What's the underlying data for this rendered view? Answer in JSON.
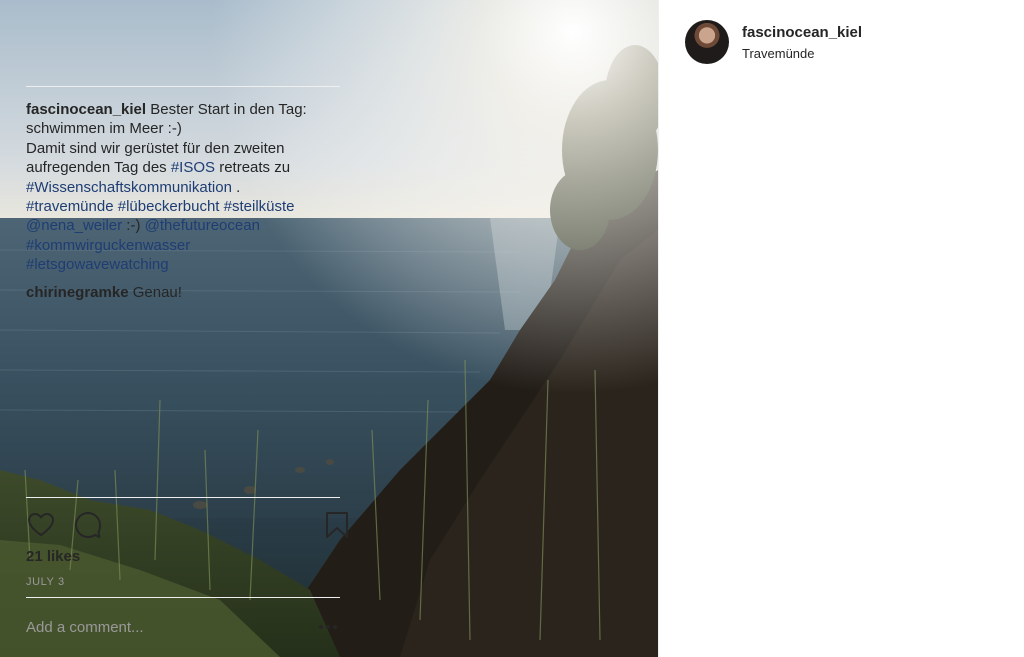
{
  "post": {
    "username": "fascinocean_kiel",
    "location": "Travemünde",
    "caption_lines": [
      [
        {
          "t": "fascinocean_kiel",
          "kind": "user"
        },
        {
          "t": " Bester Start in den Tag:",
          "kind": "text"
        }
      ],
      [
        {
          "t": "schwimmen im Meer :-)",
          "kind": "text"
        }
      ],
      [
        {
          "t": "Damit sind wir gerüstet für den zweiten",
          "kind": "text"
        }
      ],
      [
        {
          "t": "aufregenden Tag des ",
          "kind": "text"
        },
        {
          "t": "#ISOS",
          "kind": "tag"
        },
        {
          "t": " retreats zu",
          "kind": "text"
        }
      ],
      [
        {
          "t": "#Wissenschaftskommunikation",
          "kind": "tag"
        },
        {
          "t": " .",
          "kind": "text"
        }
      ],
      [
        {
          "t": "#travemünde",
          "kind": "tag"
        },
        {
          "t": " ",
          "kind": "text"
        },
        {
          "t": "#lübeckerbucht",
          "kind": "tag"
        },
        {
          "t": " ",
          "kind": "text"
        },
        {
          "t": "#steilküste",
          "kind": "tag"
        }
      ],
      [
        {
          "t": "@nena_weiler",
          "kind": "tag"
        },
        {
          "t": " :-) ",
          "kind": "text"
        },
        {
          "t": "@thefutureocean",
          "kind": "tag"
        }
      ],
      [
        {
          "t": "#kommwirguckenwasser",
          "kind": "tag"
        }
      ],
      [
        {
          "t": "#letsgowavewatching",
          "kind": "tag"
        }
      ]
    ],
    "reply": {
      "username": "chirinegramke",
      "text": " Genau!"
    },
    "likes": "21 likes",
    "date": "JULY 3",
    "add_comment_placeholder": "Add a comment...",
    "icons": {
      "like": "heart-icon",
      "comment": "comment-bubble-icon",
      "save": "bookmark-icon",
      "more": "more-options-icon"
    },
    "colors": {
      "hashtag": "#1e3d74",
      "text": "#262626",
      "muted": "#999999"
    }
  }
}
